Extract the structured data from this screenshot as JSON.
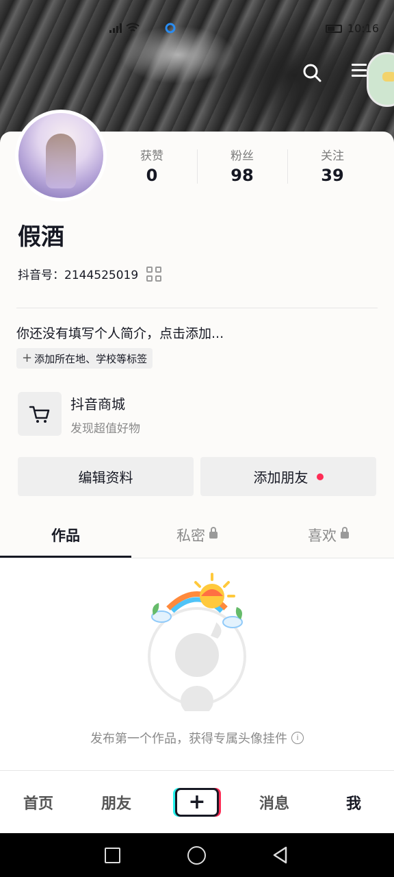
{
  "status_bar": {
    "time": "10:16"
  },
  "header": {
    "search_icon": "search-icon",
    "menu_icon": "hamburger-menu-icon"
  },
  "profile": {
    "name": "假酒",
    "douyin_id": "抖音号：2144525019",
    "bio_placeholder": "你还没有填写个人简介，点击添加...",
    "add_tags": "添加所在地、学校等标签"
  },
  "stats": [
    {
      "label": "获赞",
      "value": "0"
    },
    {
      "label": "粉丝",
      "value": "98"
    },
    {
      "label": "关注",
      "value": "39"
    }
  ],
  "mall": {
    "title": "抖音商城",
    "subtitle": "发现超值好物"
  },
  "actions": {
    "edit_profile": "编辑资料",
    "add_friends": "添加朋友"
  },
  "tabs": [
    {
      "label": "作品",
      "active": true,
      "locked": false
    },
    {
      "label": "私密",
      "active": false,
      "locked": true
    },
    {
      "label": "喜欢",
      "active": false,
      "locked": true
    }
  ],
  "empty_state": {
    "text": "发布第一个作品，获得专属头像挂件"
  },
  "bottom_nav": {
    "home": "首页",
    "friends": "朋友",
    "create": "+",
    "messages": "消息",
    "me": "我"
  },
  "colors": {
    "accent_red": "#fe2c55",
    "accent_cyan": "#25f4ee",
    "text_primary": "#161823"
  }
}
